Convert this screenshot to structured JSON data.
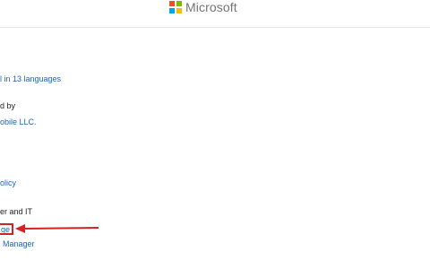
{
  "header": {
    "brand_name": "Microsoft",
    "logo_colors": [
      "#f25022",
      "#7fba00",
      "#00a4ef",
      "#ffb900"
    ]
  },
  "content": {
    "languages_link": "l in 13 languages",
    "developer_label": "d by",
    "developer_link": "obile LLC.",
    "privacy_link": "olicy",
    "section_label": "er and IT",
    "highlighted_link": "ge",
    "manager_link": "Manager"
  },
  "annotation": {
    "box_color": "#d32222",
    "arrow_color": "#d32222"
  }
}
